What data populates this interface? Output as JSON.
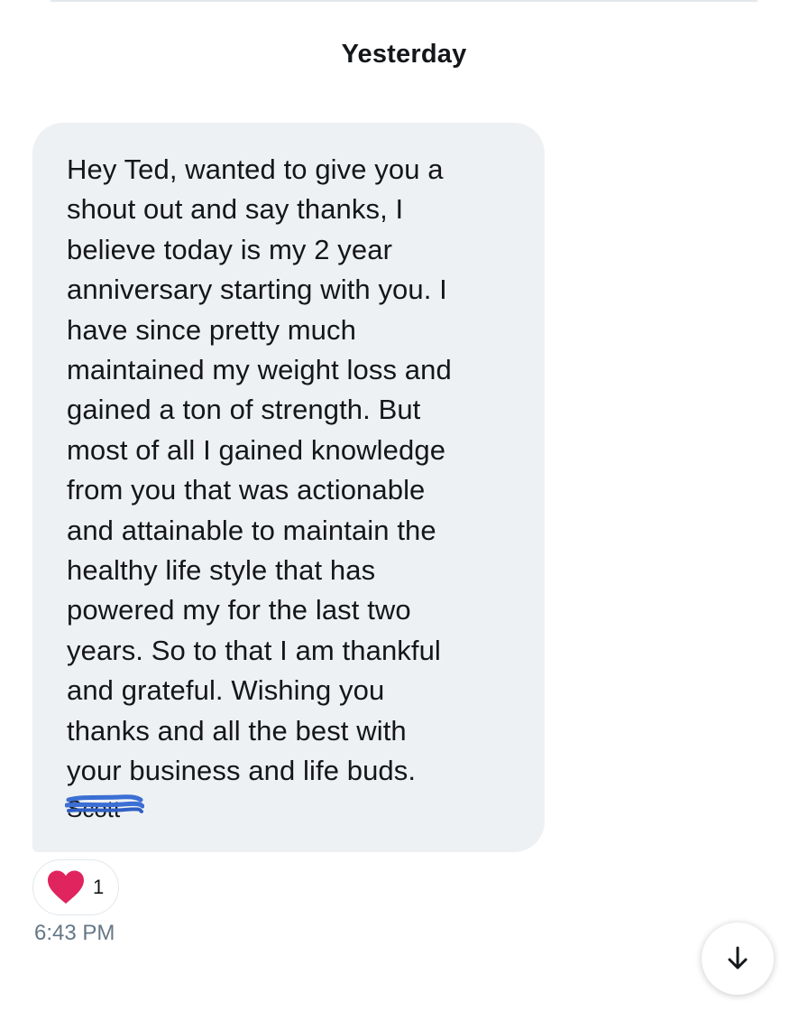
{
  "conversation": {
    "date_separator": "Yesterday"
  },
  "message": {
    "text": "Hey Ted, wanted to give you a\nshout out and say thanks, I\nbelieve today is my 2 year\nanniversary starting with you. I\nhave since pretty much\nmaintained my weight loss and\ngained a ton of strength. But\nmost of all I gained knowledge\nfrom you that was actionable\nand attainable to maintain the\nhealthy life style that has\npowered my for the last two\nyears.  So to that I am thankful\nand grateful. Wishing you\nthanks and all the best with\nyour business and life buds.",
    "signature": "Scott",
    "reaction": {
      "icon": "heart-icon",
      "color": "#e0245e",
      "count": "1"
    },
    "time": "6:43 PM"
  },
  "controls": {
    "scroll_down_icon": "arrow-down-icon"
  },
  "colors": {
    "bubble_background": "#eef1f3",
    "timestamp": "#657786",
    "redaction": "#3b6fd4"
  }
}
